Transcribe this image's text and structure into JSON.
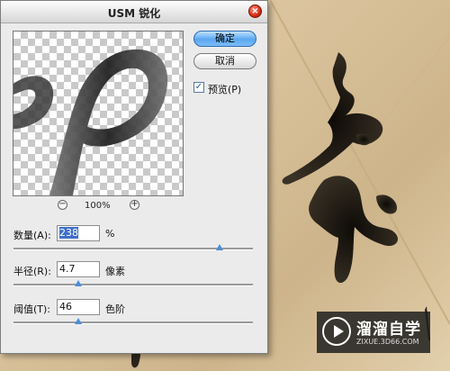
{
  "dialog": {
    "title": "USM 锐化",
    "close_symbol": "×",
    "buttons": {
      "ok": "确定",
      "cancel": "取消"
    },
    "preview_checkbox": {
      "label": "预览(P)",
      "checked": true,
      "check_mark": "✓"
    },
    "zoom": {
      "minus": "−",
      "plus": "+",
      "level": "100%"
    },
    "params": [
      {
        "label": "数量(A):",
        "value": "238",
        "unit": "%",
        "slider_fraction": 0.86
      },
      {
        "label": "半径(R):",
        "value": "4.7",
        "unit": "像素",
        "slider_fraction": 0.27
      },
      {
        "label": "阈值(T):",
        "value": "46",
        "unit": "色阶",
        "slider_fraction": 0.27
      }
    ]
  },
  "watermark": {
    "name": "溜溜自学",
    "url": "ZIXUE.3D66.COM",
    "icon": "play-logo-icon"
  },
  "colors": {
    "accent": "#5aa7f0",
    "ink": "#1e1a14",
    "paper": "#d9c29c"
  }
}
